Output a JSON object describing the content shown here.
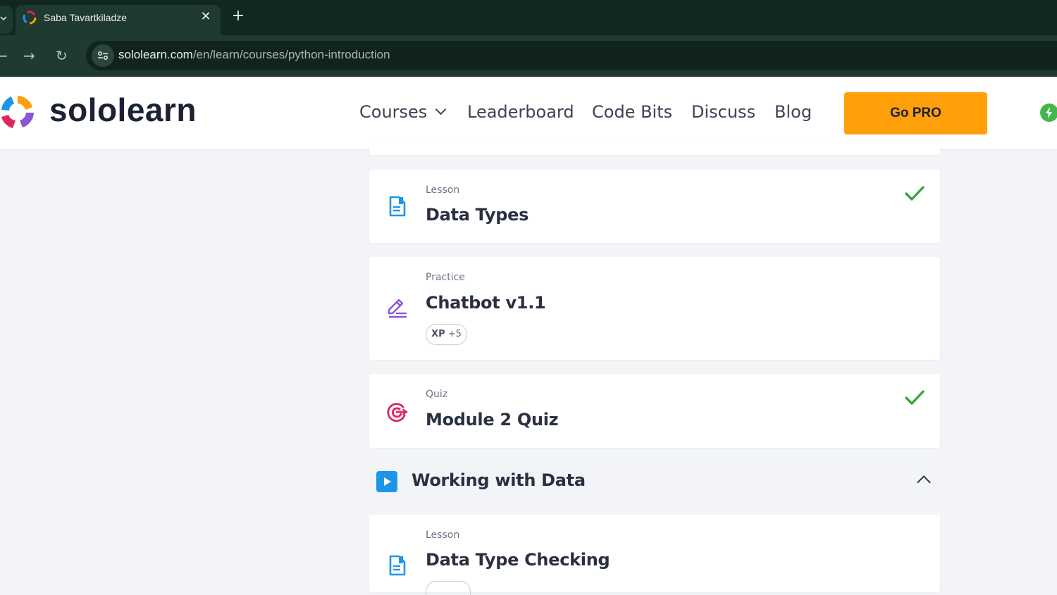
{
  "browser": {
    "tab_title": "Saba Tavartkiladze",
    "close_glyph": "✕",
    "new_tab_glyph": "+",
    "url_host": "sololearn.com",
    "url_path": "/en/learn/courses/python-introduction",
    "back_glyph": "←",
    "forward_glyph": "→",
    "reload_glyph": "↻"
  },
  "header": {
    "logo_text": "sololearn",
    "nav": {
      "courses": "Courses",
      "leaderboard": "Leaderboard",
      "code_bits": "Code Bits",
      "discuss": "Discuss",
      "blog": "Blog"
    },
    "go_pro": "Go PRO",
    "colors": {
      "go_pro": "#ff9f0a",
      "bolt": "#44b64b"
    }
  },
  "items": [
    {
      "type": "Lesson",
      "title": "Data Types",
      "icon": "lesson-document-icon",
      "completed": true
    },
    {
      "type": "Practice",
      "title": "Chatbot v1.1",
      "icon": "practice-pencil-icon",
      "completed": false,
      "xp_label": "XP",
      "xp_value": "+5"
    },
    {
      "type": "Quiz",
      "title": "Module 2 Quiz",
      "icon": "quiz-target-icon",
      "completed": true
    }
  ],
  "section": {
    "title": "Working with Data",
    "expanded": true
  },
  "next_item": {
    "type": "Lesson",
    "title": "Data Type Checking",
    "icon": "lesson-document-icon"
  },
  "colors": {
    "check": "#3aa53a",
    "lesson_icon": "#1d96e8",
    "practice_icon": "#8a56d8",
    "quiz_icon": "#e0245e"
  }
}
